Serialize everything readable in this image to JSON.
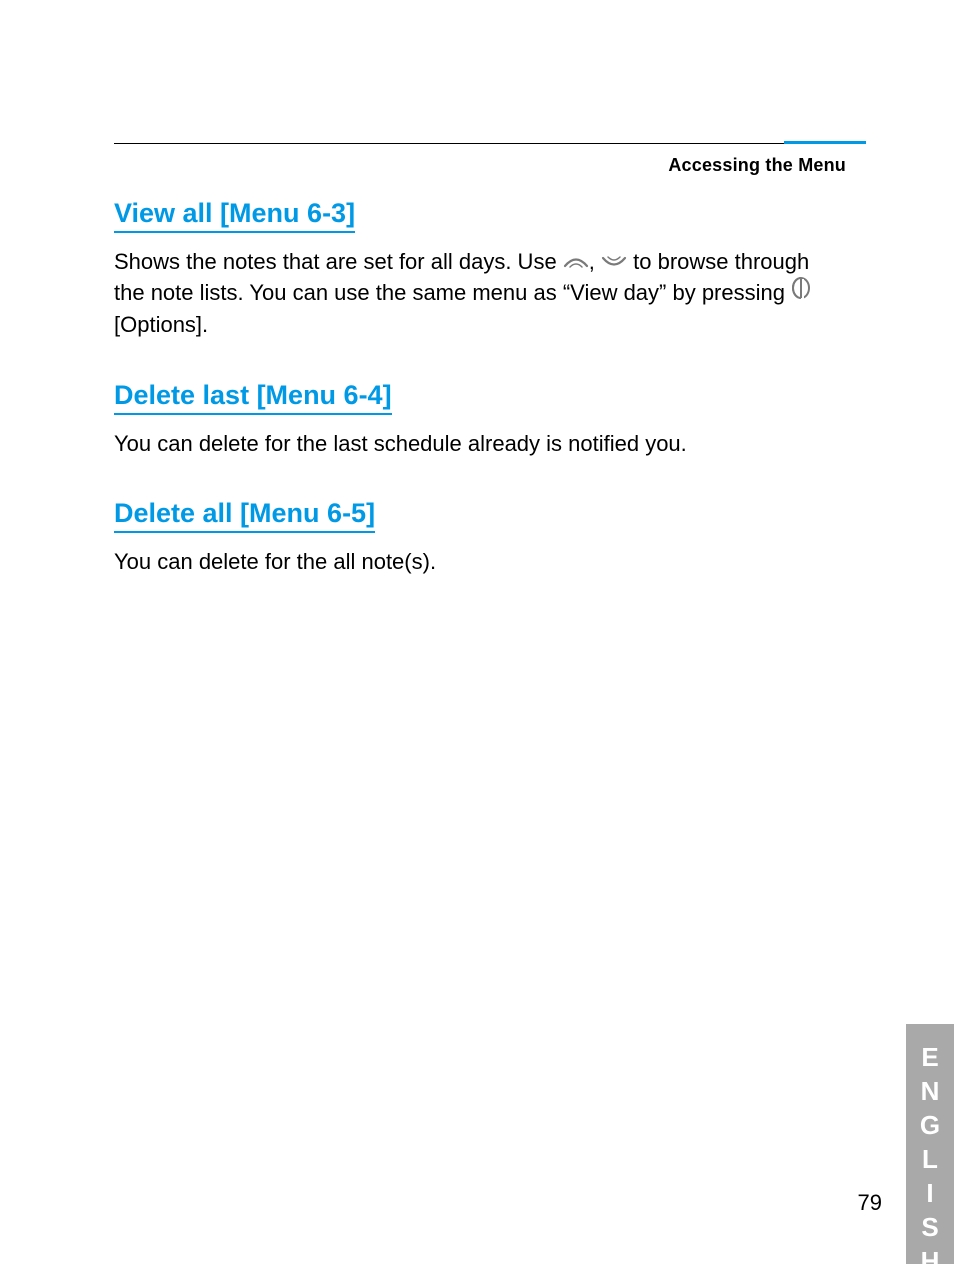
{
  "header": {
    "running_title": "Accessing the Menu"
  },
  "sections": [
    {
      "id": "view-all",
      "title": "View all [Menu 6-3]",
      "body_pre": "Shows the notes that are set for all days. Use ",
      "body_mid": ", ",
      "body_after_icons": " to browse through the note lists. You can use the same menu as “View day” by pressing ",
      "body_end": " [Options]."
    },
    {
      "id": "delete-last",
      "title": "Delete last [Menu 6-4]",
      "body": "You can delete for the last schedule already is notified you."
    },
    {
      "id": "delete-all",
      "title": "Delete all [Menu 6-5]",
      "body": "You can delete for the all note(s)."
    }
  ],
  "side_tab": "ENGLISH",
  "page_number": "79"
}
